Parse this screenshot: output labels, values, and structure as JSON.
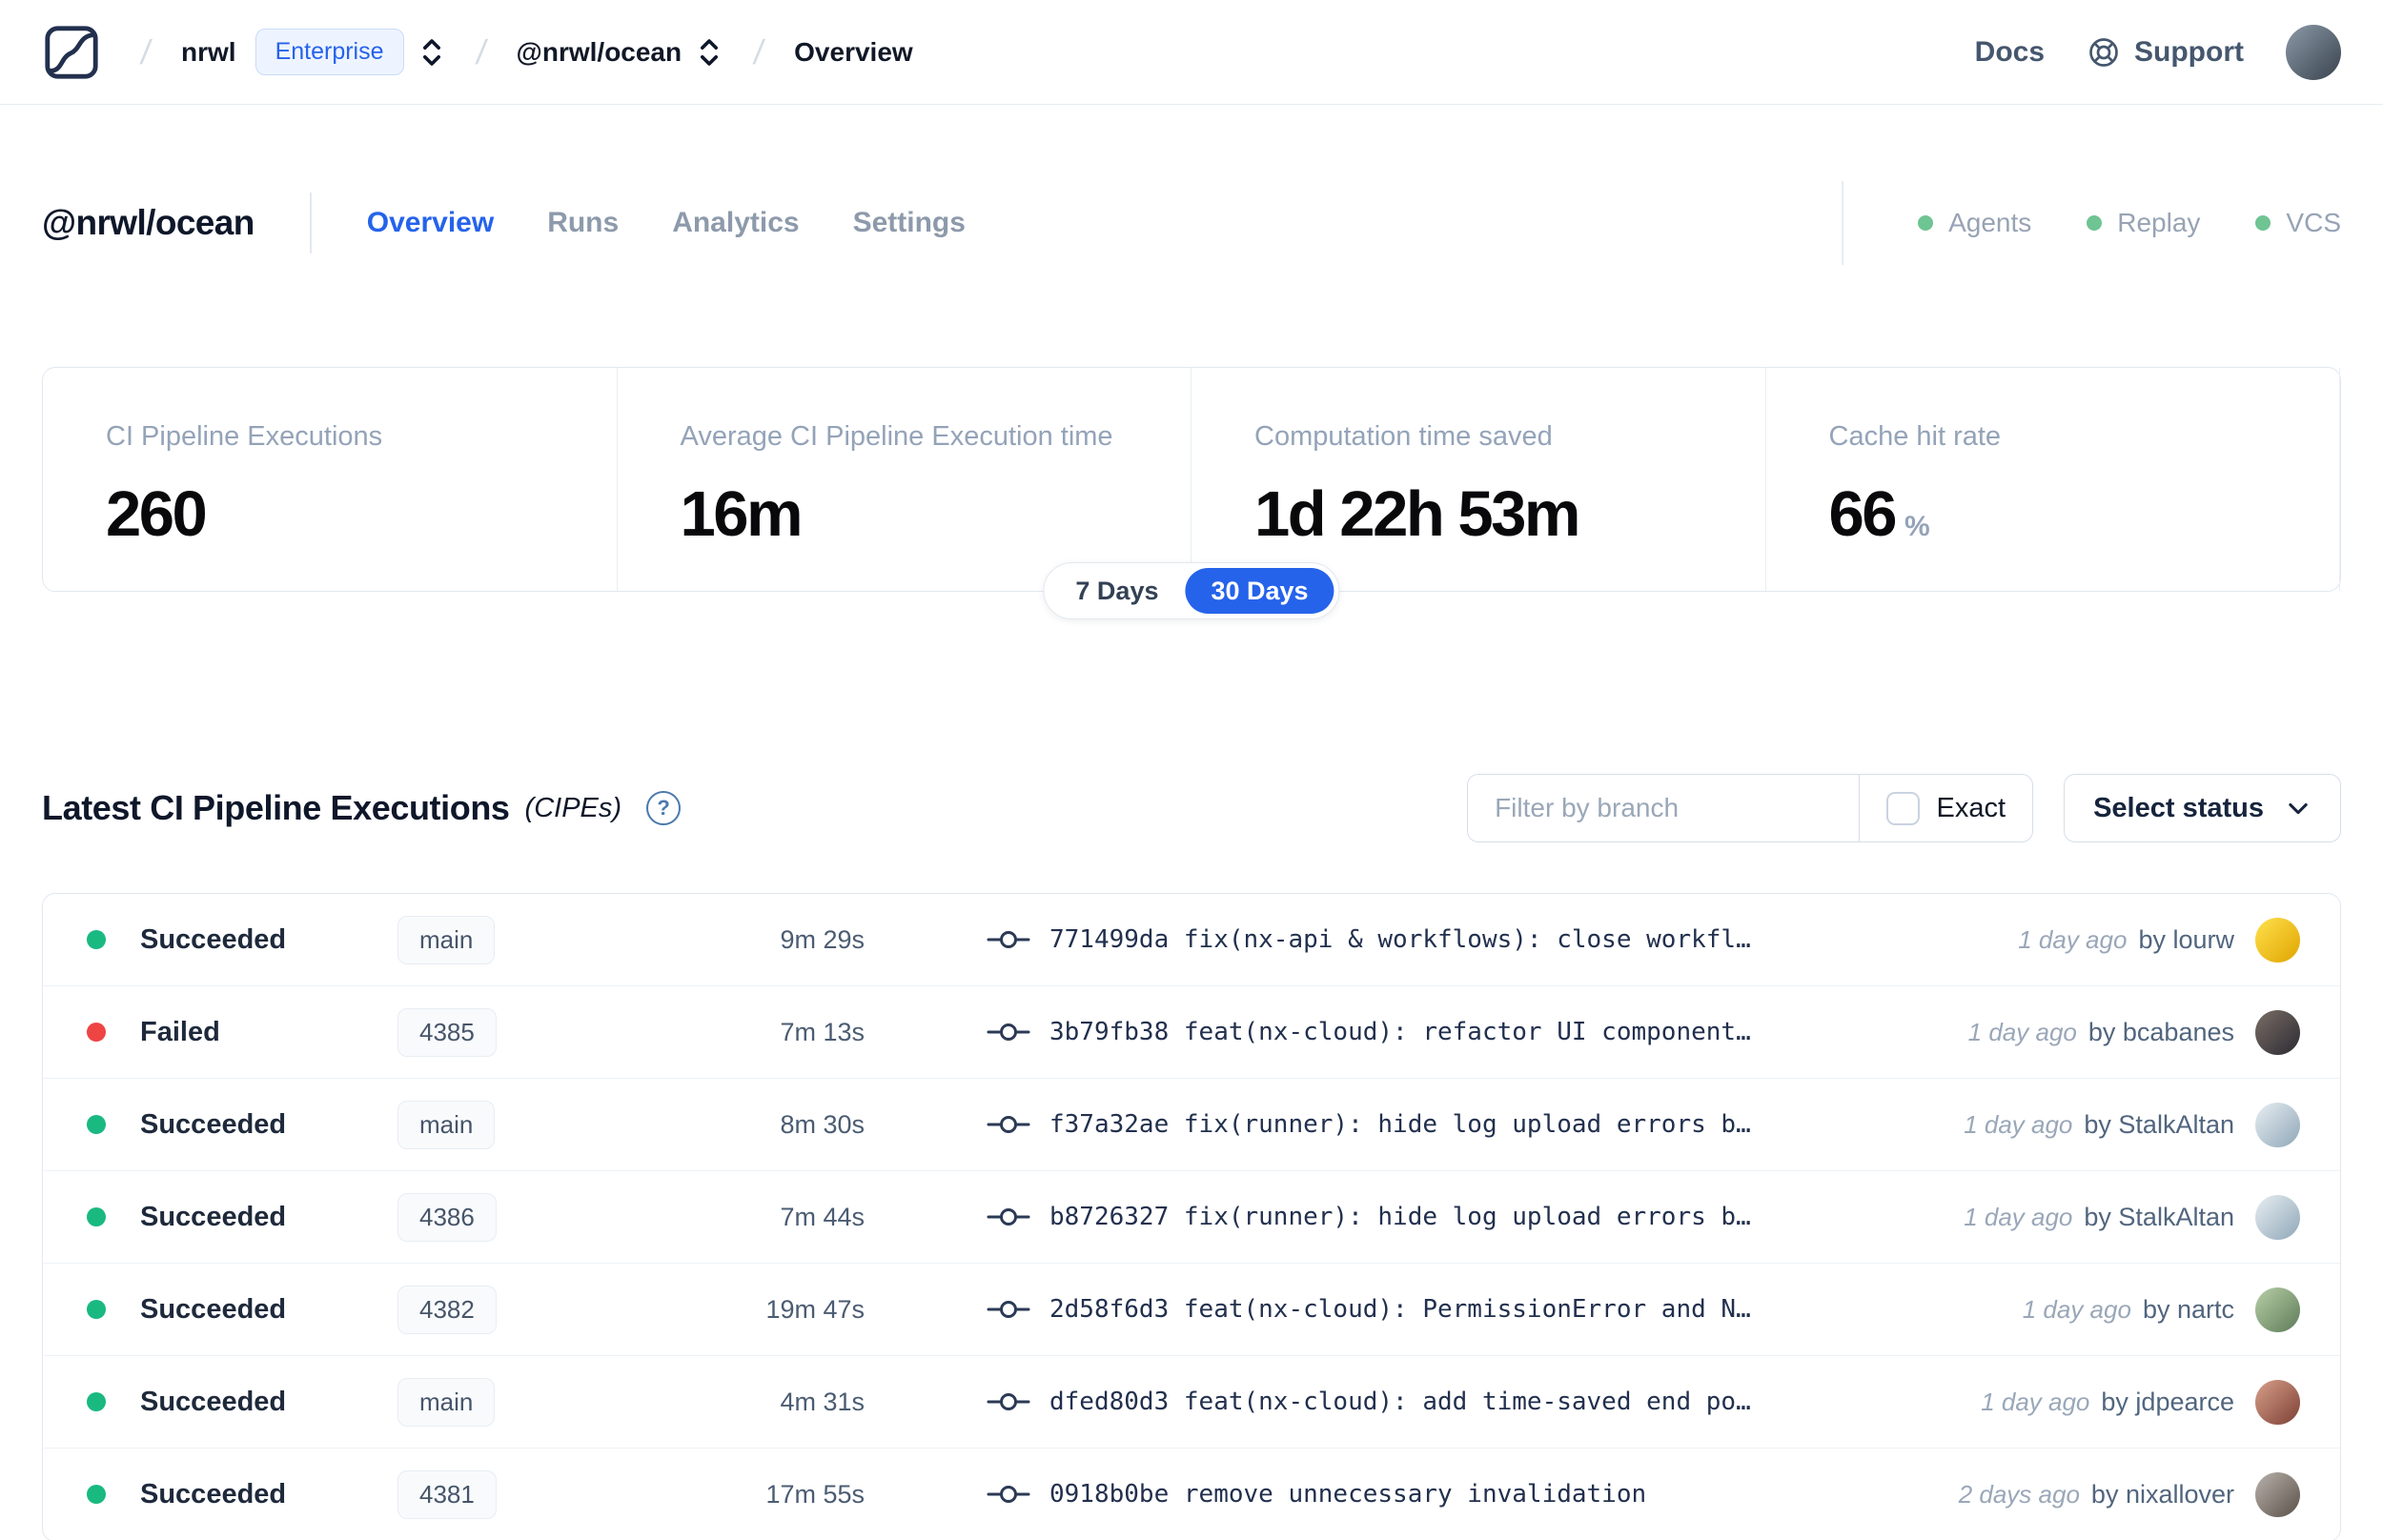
{
  "navbar": {
    "org": "nrwl",
    "badge": "Enterprise",
    "workspace": "@nrwl/ocean",
    "page": "Overview",
    "docs_label": "Docs",
    "support_label": "Support",
    "avatar_colors": [
      "#8c9aa8",
      "#39424e"
    ]
  },
  "header": {
    "workspace": "@nrwl/ocean",
    "tabs": [
      {
        "label": "Overview",
        "active": true
      },
      {
        "label": "Runs",
        "active": false
      },
      {
        "label": "Analytics",
        "active": false
      },
      {
        "label": "Settings",
        "active": false
      }
    ],
    "indicators": [
      {
        "label": "Agents"
      },
      {
        "label": "Replay"
      },
      {
        "label": "VCS"
      }
    ],
    "indicator_dot_color": "#6ec492"
  },
  "stats": {
    "cards": [
      {
        "label": "CI Pipeline Executions",
        "value": "260",
        "suffix": ""
      },
      {
        "label": "Average CI Pipeline Execution time",
        "value": "16m",
        "suffix": ""
      },
      {
        "label": "Computation time saved",
        "value": "1d 22h 53m",
        "suffix": ""
      },
      {
        "label": "Cache hit rate",
        "value": "66",
        "suffix": "%"
      }
    ]
  },
  "period_toggle": {
    "options": [
      "7 Days",
      "30 Days"
    ],
    "selected": "30 Days",
    "accent": "#2563eb"
  },
  "cipe": {
    "title": "Latest CI Pipeline Executions",
    "title_suffix": "(CIPEs)",
    "filter_placeholder": "Filter by branch",
    "exact_label": "Exact",
    "status_select_label": "Select status"
  },
  "table": {
    "status_colors": {
      "Succeeded": "#19b981",
      "Failed": "#ef4444"
    },
    "rows": [
      {
        "status": "Succeeded",
        "branch": "main",
        "duration": "9m 29s",
        "commit_hash": "771499da",
        "commit_message": "fix(nx-api & workflows): close workfl…",
        "time_ago": "1 day ago",
        "author": "by lourw",
        "avatar_colors": [
          "#ffe14d",
          "#e0a400"
        ]
      },
      {
        "status": "Failed",
        "branch": "4385",
        "duration": "7m 13s",
        "commit_hash": "3b79fb38",
        "commit_message": "feat(nx-cloud): refactor UI component…",
        "time_ago": "1 day ago",
        "author": "by bcabanes",
        "avatar_colors": [
          "#7a6e66",
          "#2c2a33"
        ]
      },
      {
        "status": "Succeeded",
        "branch": "main",
        "duration": "8m 30s",
        "commit_hash": "f37a32ae",
        "commit_message": "fix(runner): hide log upload errors b…",
        "time_ago": "1 day ago",
        "author": "by StalkAltan",
        "avatar_colors": [
          "#e8eef2",
          "#8fa7b8"
        ]
      },
      {
        "status": "Succeeded",
        "branch": "4386",
        "duration": "7m 44s",
        "commit_hash": "b8726327",
        "commit_message": "fix(runner): hide log upload errors b…",
        "time_ago": "1 day ago",
        "author": "by StalkAltan",
        "avatar_colors": [
          "#e8eef2",
          "#8fa7b8"
        ]
      },
      {
        "status": "Succeeded",
        "branch": "4382",
        "duration": "19m 47s",
        "commit_hash": "2d58f6d3",
        "commit_message": "feat(nx-cloud): PermissionError and N…",
        "time_ago": "1 day ago",
        "author": "by nartc",
        "avatar_colors": [
          "#b9d0a8",
          "#5c7a57"
        ]
      },
      {
        "status": "Succeeded",
        "branch": "main",
        "duration": "4m 31s",
        "commit_hash": "dfed80d3",
        "commit_message": "feat(nx-cloud): add time-saved end po…",
        "time_ago": "1 day ago",
        "author": "by jdpearce",
        "avatar_colors": [
          "#d9a08a",
          "#7c3f35"
        ]
      },
      {
        "status": "Succeeded",
        "branch": "4381",
        "duration": "17m 55s",
        "commit_hash": "0918b0be",
        "commit_message": "remove unnecessary invalidation",
        "time_ago": "2 days ago",
        "author": "by nixallover",
        "avatar_colors": [
          "#b9b2ac",
          "#5a5048"
        ]
      }
    ]
  }
}
